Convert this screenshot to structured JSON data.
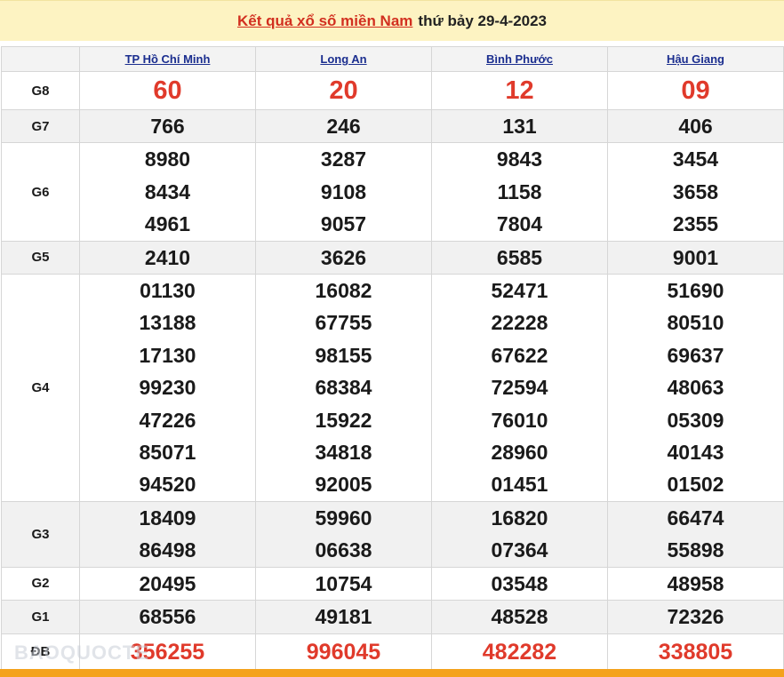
{
  "header": {
    "link_text": "Kết quả xổ số miền Nam",
    "date_text": "thứ bảy 29-4-2023"
  },
  "provinces": [
    "TP Hồ Chí Minh",
    "Long An",
    "Bình Phước",
    "Hậu Giang"
  ],
  "rows": [
    {
      "label": "G8",
      "values": [
        [
          "60"
        ],
        [
          "20"
        ],
        [
          "12"
        ],
        [
          "09"
        ]
      ]
    },
    {
      "label": "G7",
      "values": [
        [
          "766"
        ],
        [
          "246"
        ],
        [
          "131"
        ],
        [
          "406"
        ]
      ]
    },
    {
      "label": "G6",
      "values": [
        [
          "8980",
          "8434",
          "4961"
        ],
        [
          "3287",
          "9108",
          "9057"
        ],
        [
          "9843",
          "1158",
          "7804"
        ],
        [
          "3454",
          "3658",
          "2355"
        ]
      ]
    },
    {
      "label": "G5",
      "values": [
        [
          "2410"
        ],
        [
          "3626"
        ],
        [
          "6585"
        ],
        [
          "9001"
        ]
      ]
    },
    {
      "label": "G4",
      "values": [
        [
          "01130",
          "13188",
          "17130",
          "99230",
          "47226",
          "85071",
          "94520"
        ],
        [
          "16082",
          "67755",
          "98155",
          "68384",
          "15922",
          "34818",
          "92005"
        ],
        [
          "52471",
          "22228",
          "67622",
          "72594",
          "76010",
          "28960",
          "01451"
        ],
        [
          "51690",
          "80510",
          "69637",
          "48063",
          "05309",
          "40143",
          "01502"
        ]
      ]
    },
    {
      "label": "G3",
      "values": [
        [
          "18409",
          "86498"
        ],
        [
          "59960",
          "06638"
        ],
        [
          "16820",
          "07364"
        ],
        [
          "66474",
          "55898"
        ]
      ]
    },
    {
      "label": "G2",
      "values": [
        [
          "20495"
        ],
        [
          "10754"
        ],
        [
          "03548"
        ],
        [
          "48958"
        ]
      ]
    },
    {
      "label": "G1",
      "values": [
        [
          "68556"
        ],
        [
          "49181"
        ],
        [
          "48528"
        ],
        [
          "72326"
        ]
      ]
    },
    {
      "label": "ĐB",
      "values": [
        [
          "356255"
        ],
        [
          "996045"
        ],
        [
          "482282"
        ],
        [
          "338805"
        ]
      ]
    }
  ],
  "watermark": "BAOQUOCTE",
  "colors": {
    "header_bg": "#fdf3c2",
    "header_link": "#d22f1f",
    "province_link": "#1b2e8f",
    "special_red": "#e03a2b",
    "bottom_bar": "#f4a21c"
  }
}
